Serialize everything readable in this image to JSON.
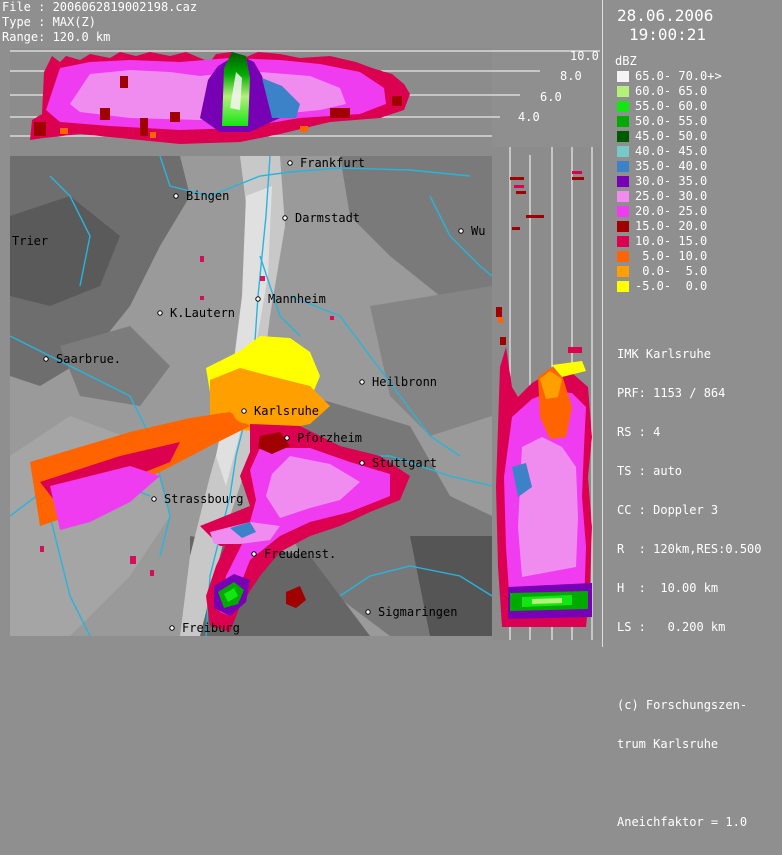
{
  "header": {
    "file": "File : 2006062819002198.caz",
    "type": "Type : MAX(Z)",
    "range": "Range: 120.0 km"
  },
  "datetime": {
    "date": "28.06.2006",
    "time": "19:00:21"
  },
  "altitude_labels": [
    "10.0",
    "8.0",
    "6.0",
    "4.0"
  ],
  "legend": {
    "unit": "dBZ",
    "items": [
      {
        "label": "65.0- 70.0+>",
        "color": "#f4f4f4"
      },
      {
        "label": "60.0- 65.0",
        "color": "#b4f07a"
      },
      {
        "label": "55.0- 60.0",
        "color": "#14e614"
      },
      {
        "label": "50.0- 55.0",
        "color": "#00aa00"
      },
      {
        "label": "45.0- 50.0",
        "color": "#005a00"
      },
      {
        "label": "40.0- 45.0",
        "color": "#78c8c8"
      },
      {
        "label": "35.0- 40.0",
        "color": "#3c82c8"
      },
      {
        "label": "30.0- 35.0",
        "color": "#7800b4"
      },
      {
        "label": "25.0- 30.0",
        "color": "#f08cf0"
      },
      {
        "label": "20.0- 25.0",
        "color": "#f03cf0"
      },
      {
        "label": "15.0- 20.0",
        "color": "#a00000"
      },
      {
        "label": "10.0- 15.0",
        "color": "#dc0050"
      },
      {
        "label": " 5.0- 10.0",
        "color": "#ff6400"
      },
      {
        "label": " 0.0-  5.0",
        "color": "#ffa000"
      },
      {
        "label": "-5.0-  0.0",
        "color": "#ffff00"
      }
    ]
  },
  "info": [
    "IMK Karlsruhe",
    "PRF: 1153 / 864",
    "RS : 4",
    "TS : auto",
    "CC : Doppler 3",
    "R  : 120km,RES:0.500",
    "H  :  10.00 km",
    "LS :   0.200 km",
    "",
    "(c) Forschungszen-",
    "trum Karlsruhe",
    "",
    "Aneichfaktor = 1.0"
  ],
  "cities": [
    {
      "name": "Frankfurt",
      "id": "frankfurt"
    },
    {
      "name": "Bingen",
      "id": "bingen"
    },
    {
      "name": "Darmstadt",
      "id": "darmstadt"
    },
    {
      "name": "Wu",
      "id": "wuerzburg"
    },
    {
      "name": "Trier",
      "id": "trier"
    },
    {
      "name": "Mannheim",
      "id": "mannheim"
    },
    {
      "name": "K.Lautern",
      "id": "kaiserslautern"
    },
    {
      "name": "Saarbrue.",
      "id": "saarbruecken"
    },
    {
      "name": "Heilbronn",
      "id": "heilbronn"
    },
    {
      "name": "Karlsruhe",
      "id": "karlsruhe"
    },
    {
      "name": "Pforzheim",
      "id": "pforzheim"
    },
    {
      "name": "Stuttgart",
      "id": "stuttgart"
    },
    {
      "name": "Strassbourg",
      "id": "strassbourg"
    },
    {
      "name": "Freudenst.",
      "id": "freudenstadt"
    },
    {
      "name": "Sigmaringen",
      "id": "sigmaringen"
    },
    {
      "name": "Freiburg",
      "id": "freiburg"
    }
  ]
}
